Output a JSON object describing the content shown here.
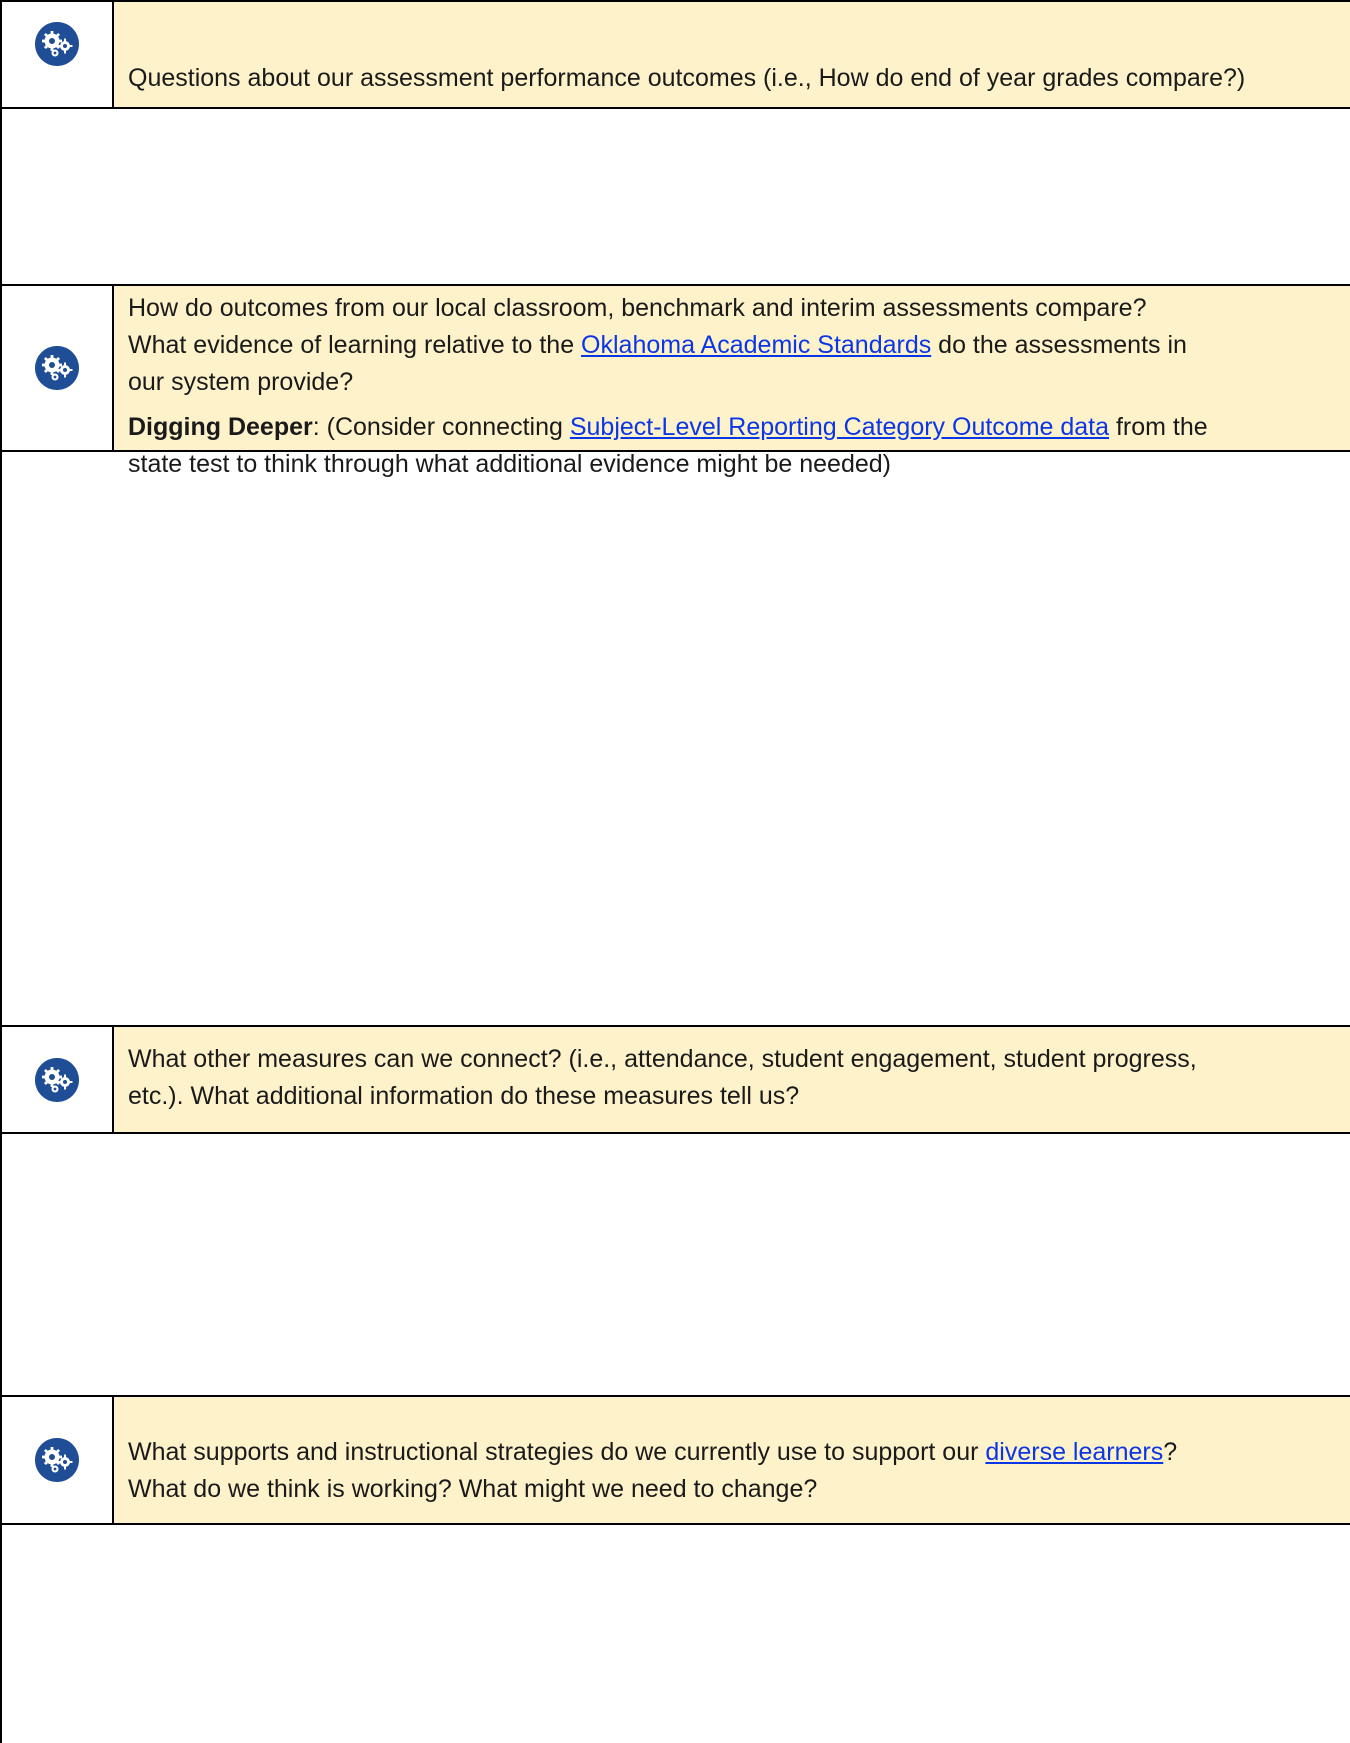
{
  "sections": [
    {
      "icon": "gears-icon",
      "lines": [
        "Questions about our assessment performance outcomes (i.e., How do end of year grades compare?)"
      ]
    },
    {
      "icon": "gears-icon",
      "p1_line1": "How do outcomes from our local classroom, benchmark and interim assessments compare?",
      "p1_line2_before": "What evidence of learning relative to the ",
      "p1_line2_link": "Oklahoma Academic Standards",
      "p1_line2_after": " do the assessments in",
      "p1_line3": "our system provide?",
      "p2_bold": "Digging Deeper",
      "p2_before": ": (Consider connecting ",
      "p2_link": "Subject-Level Reporting Category Outcome data",
      "p2_after": " from the",
      "p2_line2": "state test to think through what additional evidence might be needed)"
    },
    {
      "icon": "gears-icon",
      "lines": [
        "What other measures can we connect? (i.e., attendance, student engagement, student progress,",
        "etc.).  What additional information do these measures tell us?"
      ]
    },
    {
      "icon": "gears-icon",
      "l1_before": "What supports and instructional strategies do we currently use to support our ",
      "l1_link": "diverse learners",
      "l1_after": "?",
      "l2": "What do we think is working? What might we need to change?"
    }
  ],
  "colors": {
    "prompt_background": "#fef2cb",
    "link": "#0b36e6",
    "icon_badge": "#1f4e96",
    "border": "#000000"
  }
}
